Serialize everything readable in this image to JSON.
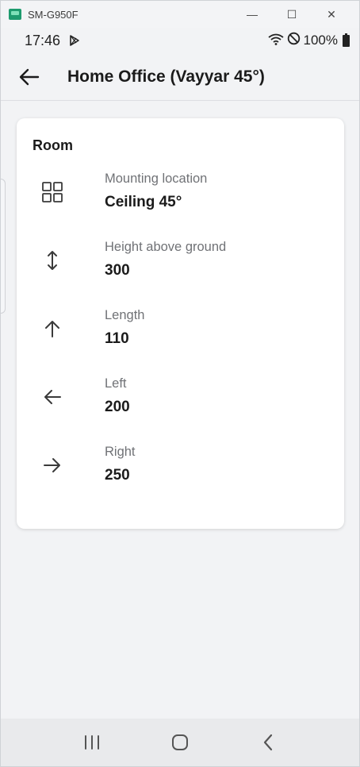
{
  "window": {
    "device_name": "SM-G950F",
    "minimize_glyph": "—",
    "maximize_glyph": "☐",
    "close_glyph": "✕"
  },
  "statusbar": {
    "time": "17:46",
    "battery_text": "100%"
  },
  "appbar": {
    "title": "Home Office (Vayyar 45°)"
  },
  "room": {
    "section_title": "Room",
    "rows": [
      {
        "icon": "grid-icon",
        "label": "Mounting location",
        "value": "Ceiling 45°"
      },
      {
        "icon": "vertical-arrows-icon",
        "label": "Height above ground",
        "value": "300"
      },
      {
        "icon": "arrow-up-icon",
        "label": "Length",
        "value": "110"
      },
      {
        "icon": "arrow-left-icon",
        "label": "Left",
        "value": "200"
      },
      {
        "icon": "arrow-right-icon",
        "label": "Right",
        "value": "250"
      }
    ]
  },
  "colors": {
    "accent_icon": "#3a3a3a",
    "label_text": "#707276",
    "card_bg": "#ffffff"
  }
}
